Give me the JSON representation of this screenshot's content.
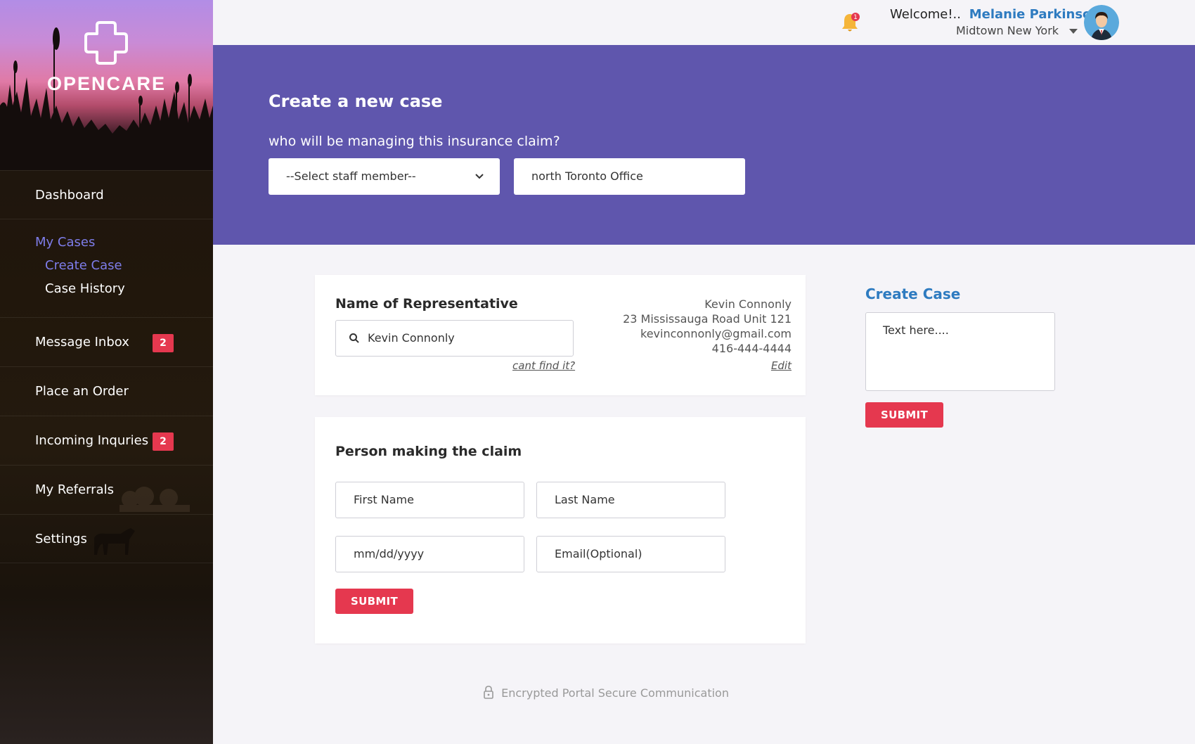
{
  "brand": {
    "name": "OPENCARE"
  },
  "sidebar": {
    "items": [
      {
        "label": "Dashboard"
      },
      {
        "label": "My Cases",
        "children": [
          {
            "label": "Create Case"
          },
          {
            "label": "Case History"
          }
        ]
      },
      {
        "label": "Message Inbox",
        "badge": "2"
      },
      {
        "label": "Place an Order"
      },
      {
        "label": "Incoming Inquries",
        "badge": "2"
      },
      {
        "label": "My Referrals"
      },
      {
        "label": "Settings"
      }
    ]
  },
  "header": {
    "notification_count": "1",
    "welcome": "Welcome!..",
    "user_name": "Melanie Parkinson",
    "location": "Midtown New York"
  },
  "banner": {
    "title": "Create a new case",
    "question": "who will be managing this insurance claim?",
    "staff_select": "--Select staff member--",
    "office": "north Toronto Office"
  },
  "representative": {
    "title": "Name of Representative",
    "search_value": "Kevin Connonly",
    "cant_find": "cant find it?",
    "info": {
      "name": "Kevin Connonly",
      "address": "23 Mississauga Road Unit 121",
      "email": "kevinconnonly@gmail.com",
      "phone": "416-444-4444"
    },
    "edit": "Edit"
  },
  "claimant": {
    "title": "Person making the claim",
    "first_name_placeholder": "First Name",
    "last_name_placeholder": "Last Name",
    "dob_placeholder": "mm/dd/yyyy",
    "email_placeholder": "Email(Optional)",
    "submit": "SUBMIT"
  },
  "create_case_panel": {
    "title": "Create Case",
    "textarea_placeholder": "Text here....",
    "submit": "SUBMIT"
  },
  "footer": {
    "note": "Encrypted Portal Secure Communication"
  },
  "colors": {
    "accent_purple": "#5f56ad",
    "link_blue": "#2e7bc0",
    "nav_active": "#7e7dea",
    "danger_red": "#e5384f"
  }
}
